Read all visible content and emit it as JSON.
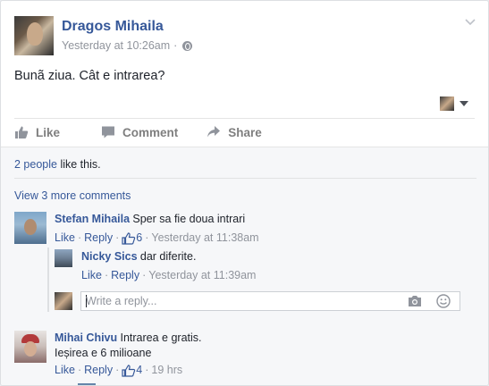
{
  "post": {
    "author": "Dragos Mihaila",
    "timestamp": "Yesterday at 10:26am",
    "separator": "·",
    "privacy_icon": "globe-icon",
    "text": "Bunã ziua. Cât e intrarea?"
  },
  "actions": {
    "like": "Like",
    "comment": "Comment",
    "share": "Share"
  },
  "likes": {
    "people": "2 people",
    "suffix": " like this."
  },
  "view_more": "View 3 more comments",
  "comments": [
    {
      "name": "Stefan Mihaila",
      "text": "Sper sa fie doua intrari",
      "like": "Like",
      "reply": "Reply",
      "likes": "6",
      "time": "Yesterday at 11:38am"
    },
    {
      "name": "Nicky Sics",
      "text": "dar diferite.",
      "like": "Like",
      "reply": "Reply",
      "time": "Yesterday at 11:39am"
    },
    {
      "name": "Mihai Chivu",
      "text": "Intrarea e gratis.",
      "text2": "Ieșirea e 6 milioane",
      "like": "Like",
      "reply": "Reply",
      "likes": "4",
      "time": "19 hrs"
    }
  ],
  "reply_box": {
    "placeholder": "Write a reply..."
  },
  "colors": {
    "link": "#365899",
    "meta": "#90949c",
    "background": "#f6f7f9"
  }
}
